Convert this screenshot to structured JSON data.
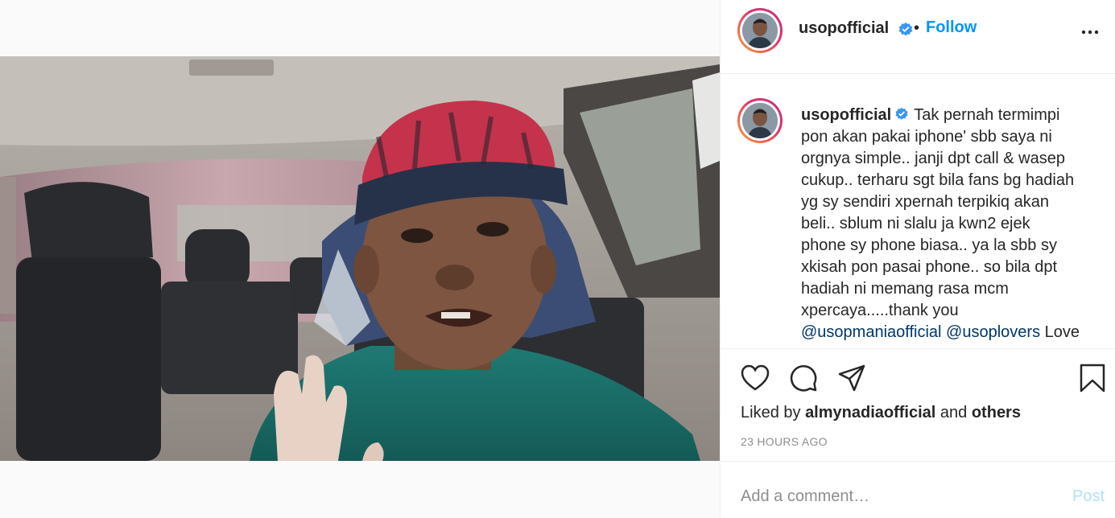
{
  "post": {
    "username": "usopofficial",
    "verified": true,
    "follow_label": "Follow",
    "separator": "•",
    "caption_lines": [
      "Tak pernah termimpi",
      "pon akan pakai iphone' sbb saya ni",
      "orgnya simple.. janji dpt call & wasep",
      "cukup.. terharu sgt bila fans bg hadiah",
      "yg sy sendiri xpernah terpikiq akan",
      "beli.. sblum ni slalu ja kwn2 ejek",
      "phone sy phone biasa.. ya la sbb sy",
      "xkisah pon pasai phone.. so bila dpt",
      "hadiah ni memang rasa mcm",
      "xpercaya.....thank you"
    ],
    "mention_1": "@usopmaniaofficial",
    "mention_2": "@usoplovers",
    "caption_tail": "Love",
    "liked_prefix": "Liked by",
    "liked_user": "almynadiaofficial",
    "liked_and": "and",
    "liked_others": "others",
    "timestamp": "23 HOURS AGO",
    "comment_placeholder": "Add a comment…",
    "post_label": "Post"
  },
  "icons": {
    "verified": "verified-badge-icon",
    "more": "more-options-icon",
    "like": "heart-icon",
    "comment": "comment-icon",
    "share": "paper-plane-icon",
    "save": "bookmark-icon",
    "mute": "muted-speaker-icon"
  },
  "colors": {
    "link": "#0095f6",
    "verified": "#3897f0",
    "mention": "#00376b",
    "post_disabled": "#b2dffc",
    "muted_text": "#8e8e8e"
  }
}
